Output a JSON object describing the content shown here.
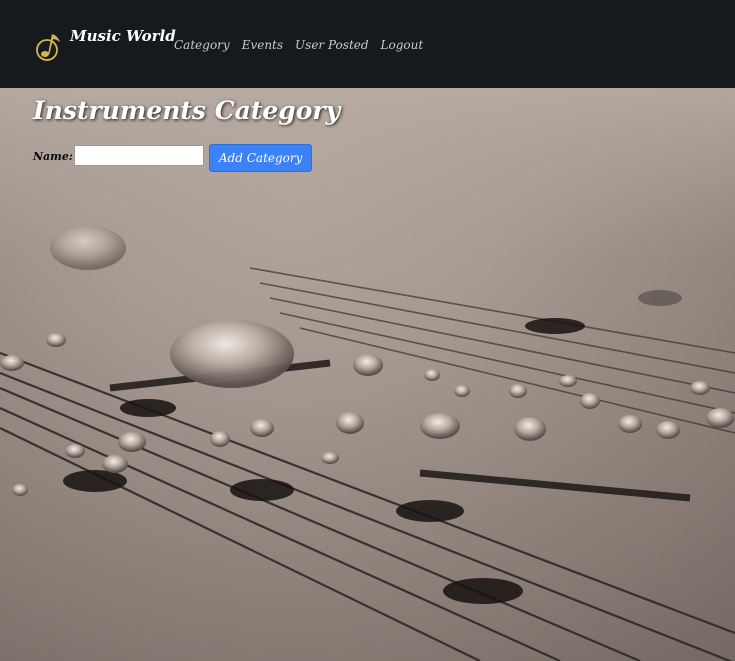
{
  "brand": {
    "name": "Music World",
    "logo_icon": "music-note-logo-icon"
  },
  "nav": {
    "items": [
      {
        "label": "Category"
      },
      {
        "label": "Events"
      },
      {
        "label": "User Posted"
      },
      {
        "label": "Logout"
      }
    ]
  },
  "page": {
    "title": "Instruments Category"
  },
  "form": {
    "name_label": "Name:",
    "name_value": "",
    "name_placeholder": "",
    "submit_label": "Add Category"
  },
  "colors": {
    "navbar": "#161a1e",
    "button": "#3b82f6",
    "accent_logo": "#d4b74a"
  }
}
